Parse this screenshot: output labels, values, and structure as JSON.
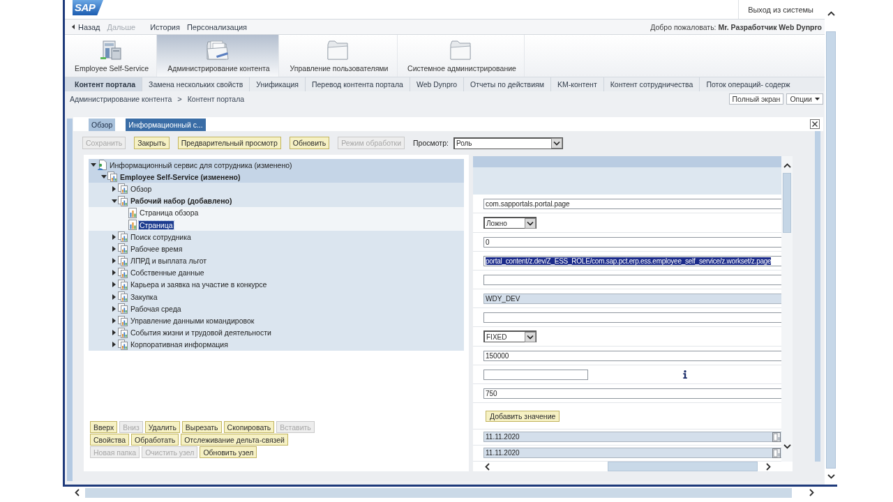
{
  "header": {
    "logo": "SAP",
    "logout": "Выход из системы"
  },
  "history_bar": {
    "links": [
      {
        "label": "Назад",
        "kind": "back",
        "disabled": false
      },
      {
        "label": "Дальше",
        "kind": "link",
        "disabled": true
      },
      {
        "label": "История",
        "kind": "link",
        "disabled": false
      },
      {
        "label": "Персонализация",
        "kind": "link",
        "disabled": false
      }
    ],
    "welcome": "Добро пожаловать: **Mr. Разработчик Web Dynpro**"
  },
  "top_nav": [
    {
      "label": "Employee Self-Service",
      "selected": false
    },
    {
      "label": "Администрирование контента",
      "selected": true
    },
    {
      "label": "Управление пользователями",
      "selected": false
    },
    {
      "label": "Системное администрирование",
      "selected": false
    }
  ],
  "sub_nav": [
    {
      "label": "Контент портала",
      "selected": true
    },
    {
      "label": "Замена нескольких свойств",
      "selected": false
    },
    {
      "label": "Унификация",
      "selected": false
    },
    {
      "label": "Перевод контента портала",
      "selected": false
    },
    {
      "label": "Web Dynpro",
      "selected": false
    },
    {
      "label": "Отчеты по действиям",
      "selected": false
    },
    {
      "label": "KM-контент",
      "selected": false
    },
    {
      "label": "Контент сотрудничества",
      "selected": false
    },
    {
      "label": "Поток операций- содерж",
      "selected": false
    }
  ],
  "breadcrumb": {
    "items": [
      "Администрирование контента",
      "Контент портала"
    ],
    "separator": ">"
  },
  "page_actions": [
    {
      "label": "Полный экран",
      "kind": "button"
    },
    {
      "label": "Опции",
      "kind": "menu"
    }
  ],
  "editor": {
    "tabs": [
      {
        "label": "Обзор",
        "selected": false
      },
      {
        "label": "Информационный с...",
        "selected": true
      }
    ],
    "toolbar": {
      "buttons": [
        {
          "label": "Сохранить",
          "disabled": true
        },
        {
          "label": "Закрыть",
          "disabled": false
        },
        {
          "label": "Предварительный просмотр",
          "disabled": false
        },
        {
          "label": "Обновить",
          "disabled": false
        },
        {
          "label": "Режим обработки",
          "disabled": true
        }
      ],
      "view": {
        "label": "Просмотр:",
        "value": "Роль"
      }
    },
    "tree": [
      {
        "label": "Информационный сервис для сотрудника (изменено)",
        "kind": "role",
        "expanded": true,
        "bold": false,
        "selected": false,
        "children": [
          {
            "label": "Employee Self-Service (изменено)",
            "kind": "folder",
            "expanded": true,
            "bold": true,
            "selected": false,
            "children": [
              {
                "label": "Обзор",
                "kind": "folder",
                "expanded": false,
                "bold": false,
                "selected": false
              },
              {
                "label": "Рабочий набор (добавлено)",
                "kind": "folder",
                "expanded": true,
                "bold": true,
                "selected": false,
                "children": [
                  {
                    "label": "Страница обзора",
                    "kind": "page",
                    "bold": false,
                    "selected": false
                  },
                  {
                    "label": "Страница",
                    "kind": "page",
                    "bold": false,
                    "selected": true
                  }
                ]
              },
              {
                "label": "Поиск сотрудника",
                "kind": "folder",
                "expanded": false,
                "bold": false,
                "selected": false
              },
              {
                "label": "Рабочее время",
                "kind": "folder",
                "expanded": false,
                "bold": false,
                "selected": false
              },
              {
                "label": "ЛПРД и выплата льгот",
                "kind": "folder",
                "expanded": false,
                "bold": false,
                "selected": false
              },
              {
                "label": "Собственные данные",
                "kind": "folder",
                "expanded": false,
                "bold": false,
                "selected": false
              },
              {
                "label": "Карьера и заявка на участие в конкурсе",
                "kind": "folder",
                "expanded": false,
                "bold": false,
                "selected": false
              },
              {
                "label": "Закупка",
                "kind": "folder",
                "expanded": false,
                "bold": false,
                "selected": false
              },
              {
                "label": "Рабочая среда",
                "kind": "folder",
                "expanded": false,
                "bold": false,
                "selected": false
              },
              {
                "label": "Управление данными командировок",
                "kind": "folder",
                "expanded": false,
                "bold": false,
                "selected": false
              },
              {
                "label": "События жизни и трудовой деятельности",
                "kind": "folder",
                "expanded": false,
                "bold": false,
                "selected": false
              },
              {
                "label": "Корпоративная информация",
                "kind": "folder",
                "expanded": false,
                "bold": false,
                "selected": false
              }
            ]
          }
        ]
      }
    ],
    "tree_actions": [
      [
        {
          "label": "Вверх",
          "disabled": false
        },
        {
          "label": "Вниз",
          "disabled": true
        },
        {
          "label": "Удалить",
          "disabled": false
        },
        {
          "label": "Вырезать",
          "disabled": false
        },
        {
          "label": "Скопировать",
          "disabled": false
        },
        {
          "label": "Вставить",
          "disabled": true
        }
      ],
      [
        {
          "label": "Свойства",
          "disabled": false
        },
        {
          "label": "Обработать",
          "disabled": false
        },
        {
          "label": "Отслеживание дельта-связей",
          "disabled": false
        }
      ],
      [
        {
          "label": "Новая папка",
          "disabled": true
        },
        {
          "label": "Очистить узел",
          "disabled": true
        },
        {
          "label": "Обновить узел",
          "disabled": false
        }
      ]
    ],
    "properties": [
      {
        "kind": "text",
        "value": "com.sapportals.portal.page",
        "readonly": false,
        "text_selected": false
      },
      {
        "kind": "select",
        "value": "Ложно",
        "readonly": false,
        "text_selected": false
      },
      {
        "kind": "text",
        "value": "0",
        "readonly": false,
        "text_selected": false
      },
      {
        "kind": "text",
        "value": "portal_content/z.dev/Z_ESS_ROLE/com.sap.pct.erp.ess.employee_self_service/z.workset/z.page",
        "readonly": false,
        "text_selected": true
      },
      {
        "kind": "text",
        "readonly": false
      },
      {
        "kind": "text",
        "value": "WDY_DEV",
        "readonly": true,
        "text_selected": false
      },
      {
        "kind": "text",
        "readonly": false
      },
      {
        "kind": "select",
        "value": "FIXED",
        "readonly": false,
        "text_selected": false
      },
      {
        "kind": "text",
        "value": "150000",
        "readonly": false,
        "text_selected": false
      },
      {
        "kind": "info",
        "readonly": false
      },
      {
        "kind": "text",
        "value": "750",
        "readonly": false,
        "text_selected": false
      },
      {
        "kind": "button",
        "label": "Добавить значение"
      },
      {
        "kind": "date",
        "value": "11.11.2020",
        "readonly": true,
        "text_selected": false
      },
      {
        "kind": "date",
        "value": "11.11.2020",
        "readonly": true,
        "text_selected": false
      }
    ]
  }
}
